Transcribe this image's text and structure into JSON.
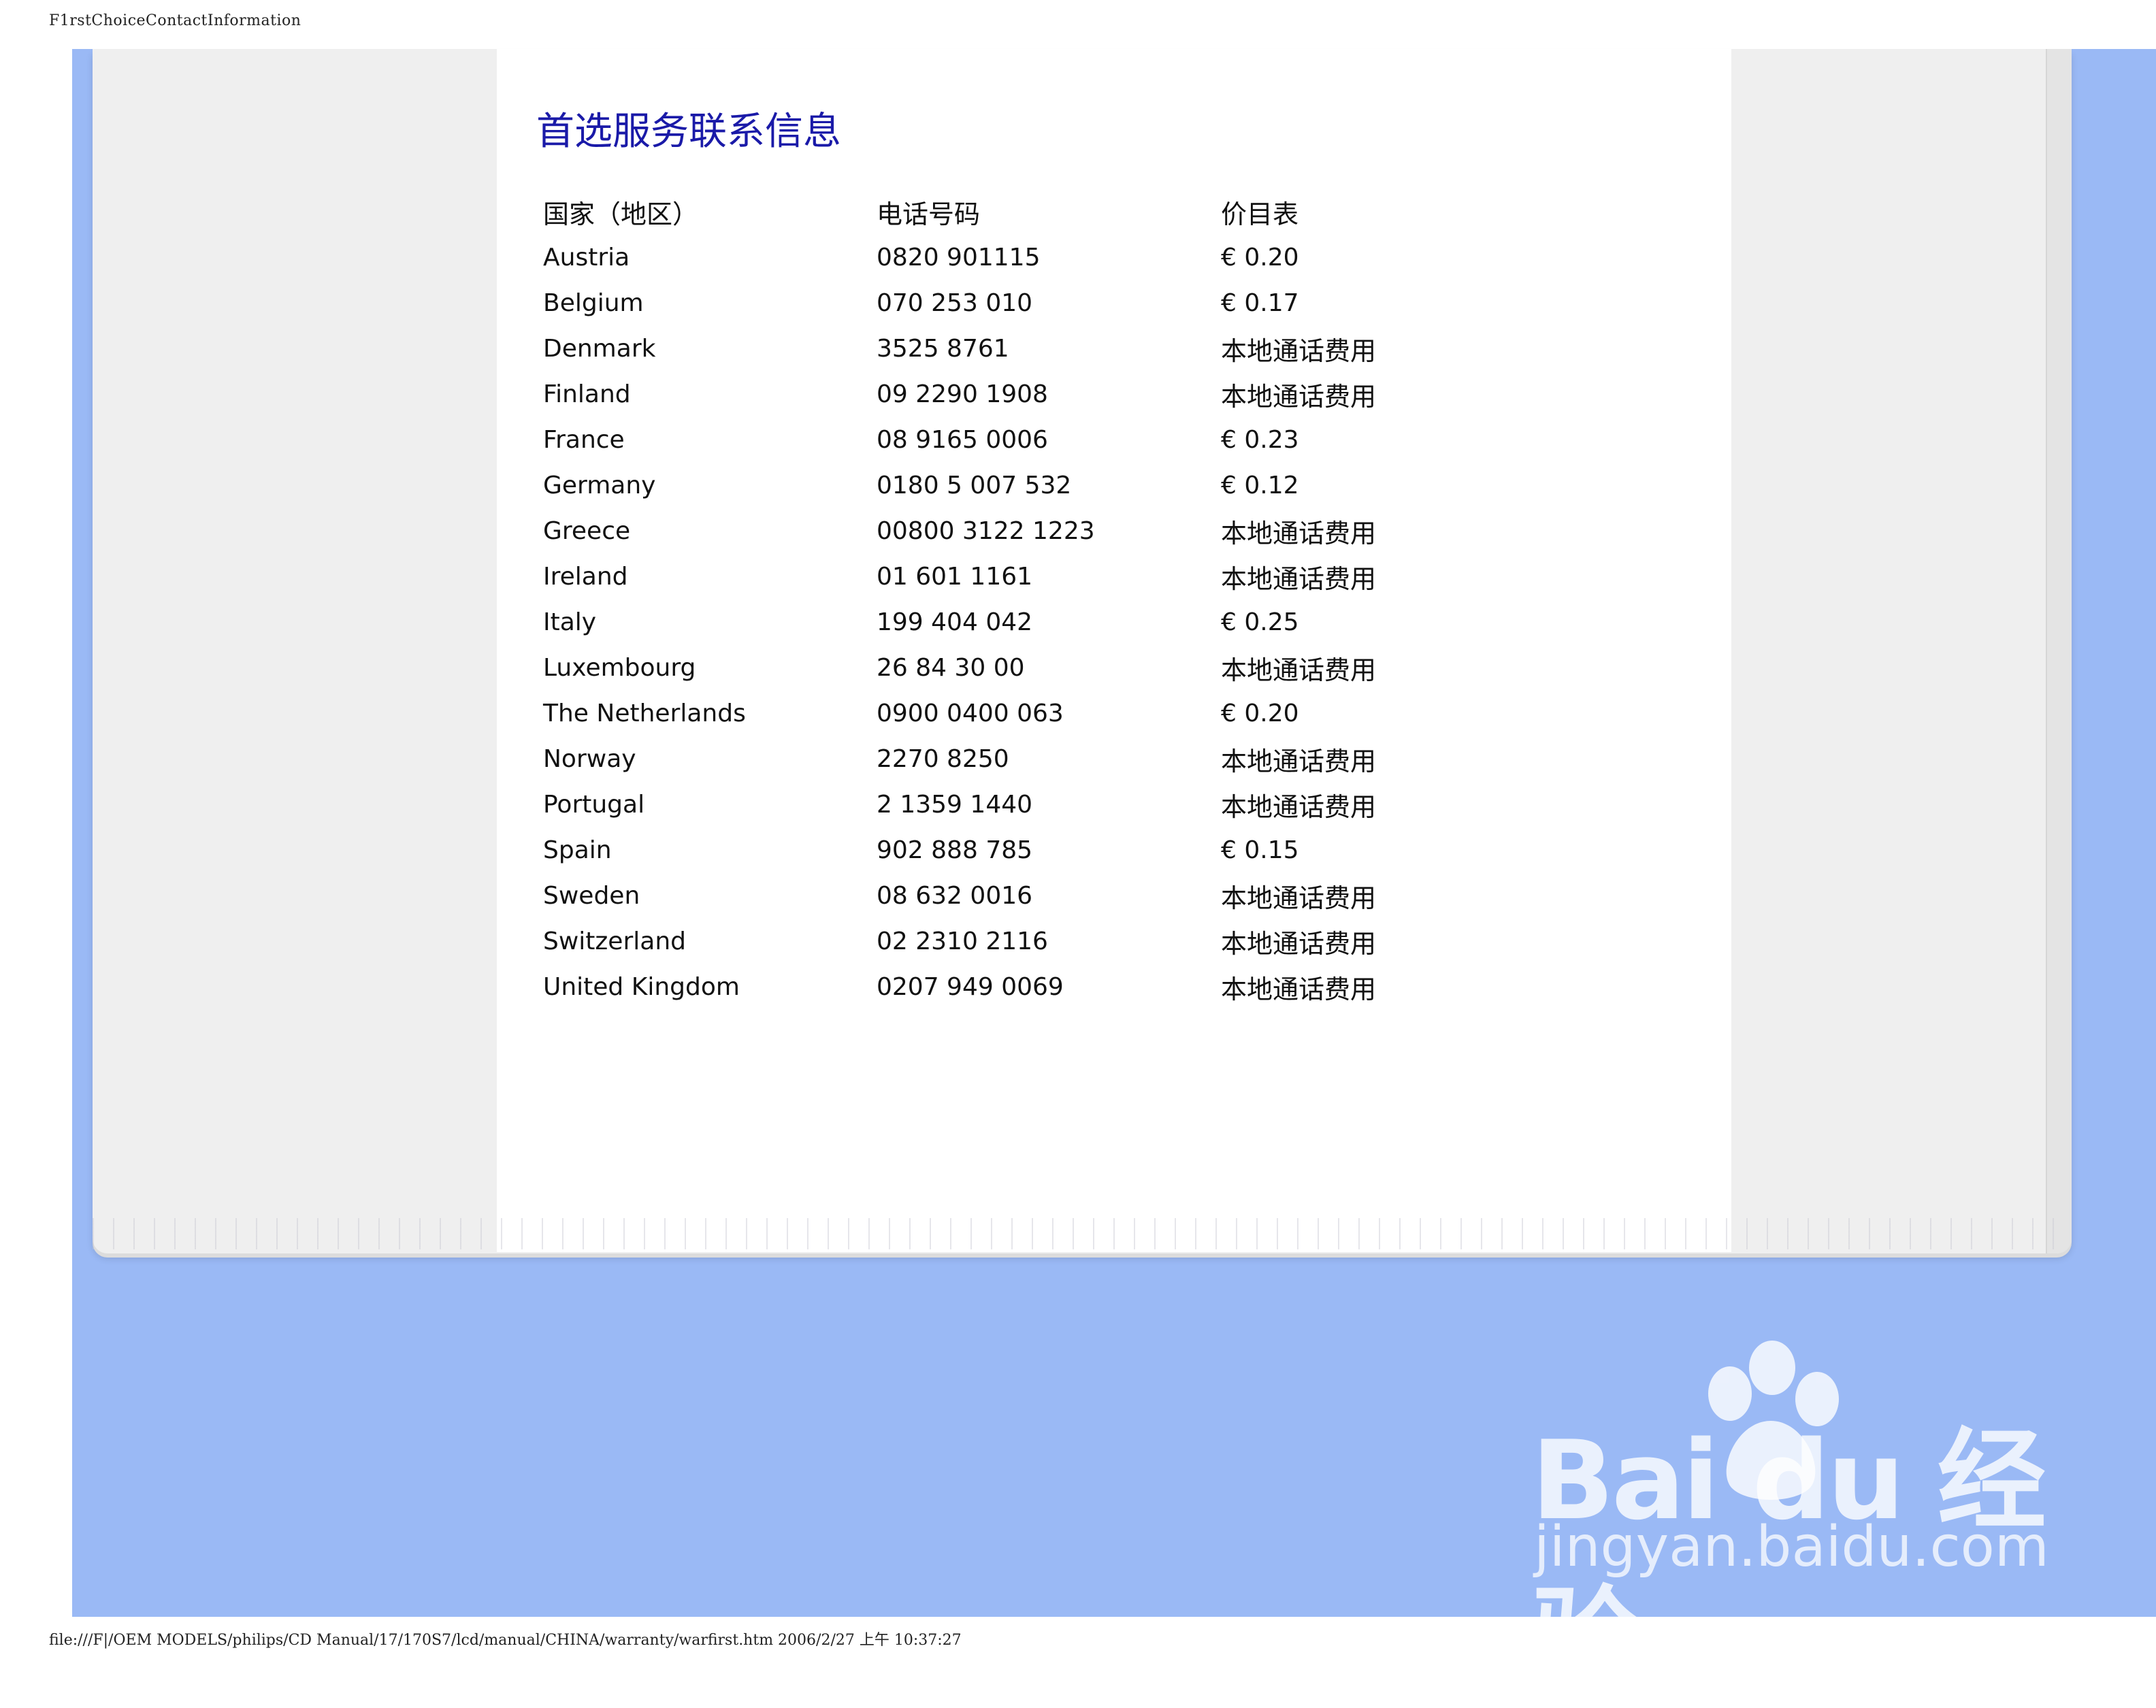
{
  "header": {
    "text": "F1rstChoiceContactInformation"
  },
  "footer": {
    "text": "file:///F|/OEM MODELS/philips/CD Manual/17/170S7/lcd/manual/CHINA/warranty/warfirst.htm 2006/2/27 上午 10:37:27"
  },
  "page": {
    "title": "首选服务联系信息"
  },
  "table": {
    "headers": [
      "国家（地区）",
      "电话号码",
      "价目表"
    ],
    "rows": [
      {
        "country": "Austria",
        "phone": "0820 901115",
        "price": "€ 0.20"
      },
      {
        "country": "Belgium",
        "phone": "070 253 010",
        "price": "€ 0.17"
      },
      {
        "country": "Denmark",
        "phone": "3525 8761",
        "price": "本地通话费用"
      },
      {
        "country": "Finland",
        "phone": "09 2290 1908",
        "price": "本地通话费用"
      },
      {
        "country": "France",
        "phone": "08 9165 0006",
        "price": "€ 0.23"
      },
      {
        "country": "Germany",
        "phone": "0180 5 007 532",
        "price": "€ 0.12"
      },
      {
        "country": "Greece",
        "phone": "00800 3122 1223",
        "price": "本地通话费用"
      },
      {
        "country": "Ireland",
        "phone": "01 601 1161",
        "price": "本地通话费用"
      },
      {
        "country": "Italy",
        "phone": "199 404 042",
        "price": "€ 0.25"
      },
      {
        "country": "Luxembourg",
        "phone": "26 84 30 00",
        "price": "本地通话费用"
      },
      {
        "country": "The Netherlands",
        "phone": "0900 0400 063",
        "price": "€ 0.20"
      },
      {
        "country": "Norway",
        "phone": "2270 8250",
        "price": "本地通话费用"
      },
      {
        "country": "Portugal",
        "phone": "2 1359 1440",
        "price": "本地通话费用"
      },
      {
        "country": "Spain",
        "phone": "902 888 785",
        "price": "€ 0.15"
      },
      {
        "country": "Sweden",
        "phone": "08 632 0016",
        "price": "本地通话费用"
      },
      {
        "country": "Switzerland",
        "phone": "02 2310 2116",
        "price": "本地通话费用"
      },
      {
        "country": "United Kingdom",
        "phone": "0207 949 0069",
        "price": "本地通话费用"
      }
    ]
  },
  "watermark": {
    "brand": "Bai du 经验",
    "url": "jingyan.baidu.com"
  },
  "colors": {
    "title": "#1a1aa8",
    "background_blue": "#9ab9f5",
    "frame_gray": "#efefef"
  }
}
